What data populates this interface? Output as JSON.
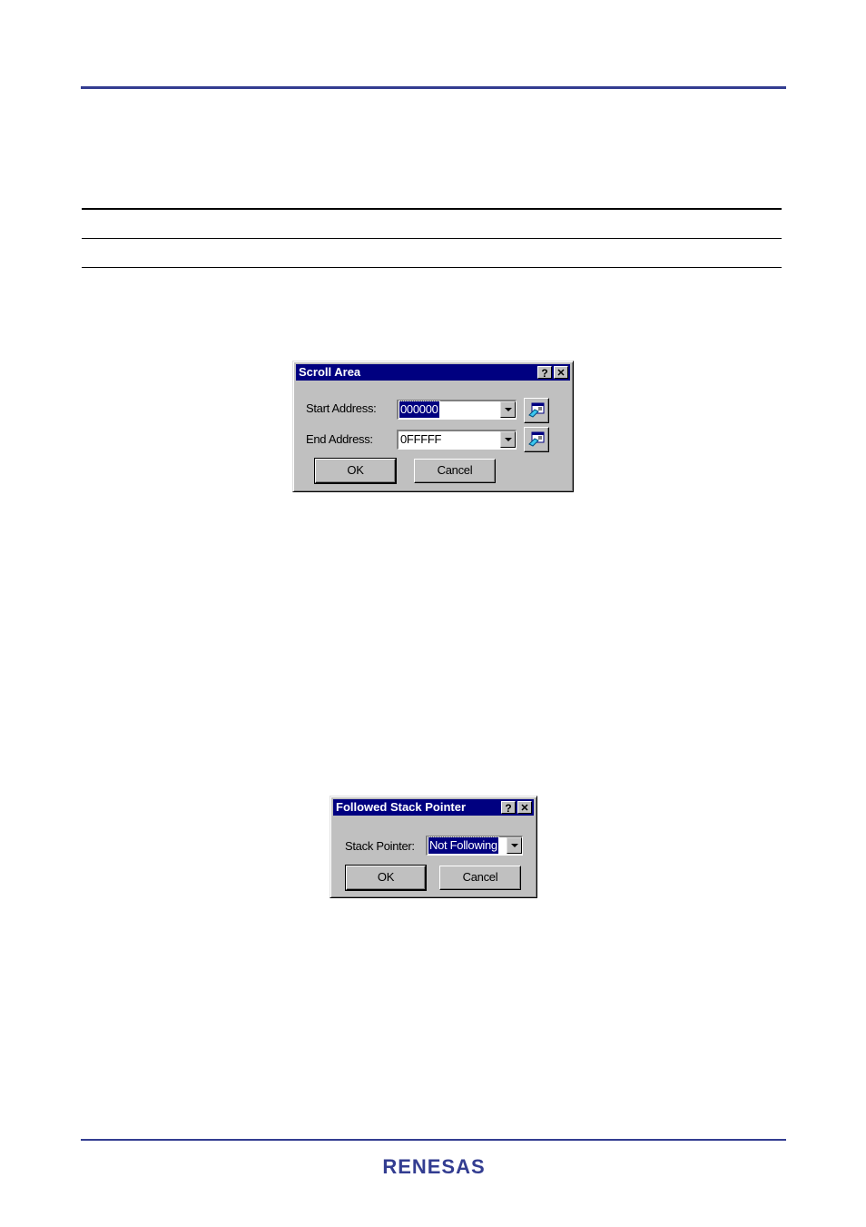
{
  "page": {
    "brand": "RENESAS",
    "colors": {
      "rule": "#333d91",
      "brand": "#333d91",
      "titlebar": "#000080",
      "dialog_face": "#c0c0c0"
    }
  },
  "scroll_area_dialog": {
    "title": "Scroll Area",
    "help_icon": "?",
    "close_icon": "✕",
    "start_address_label": "Start Address:",
    "start_address_value": "000000",
    "end_address_label": "End Address:",
    "end_address_value": "0FFFFF",
    "ok_label": "OK",
    "cancel_label": "Cancel",
    "icon_button_icon": "label-tag-icon"
  },
  "stack_pointer_dialog": {
    "title": "Followed Stack Pointer",
    "help_icon": "?",
    "close_icon": "✕",
    "stack_pointer_label": "Stack Pointer:",
    "stack_pointer_value": "Not Following",
    "ok_label": "OK",
    "cancel_label": "Cancel"
  }
}
